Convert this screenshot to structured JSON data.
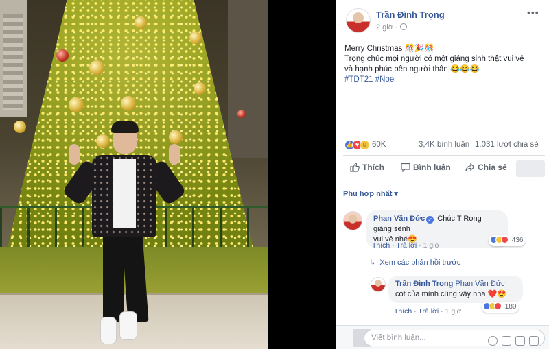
{
  "post": {
    "author": "Trần Đình Trọng",
    "time": "2 giờ",
    "more_icon": "more-options-icon",
    "text_line1": "Merry Christmas 🎊🎉🎊",
    "text_line2": "Trọng chúc mọi người có một giáng sinh thật vui vẻ",
    "text_line3": "và hạnh phúc bên người thân 😂😂😂",
    "hashtags": "#TDT21 #Noel"
  },
  "reactions": {
    "count": "60K",
    "comments": "3,4K bình luận",
    "shares": "1.031 lượt chia sẻ"
  },
  "actions": {
    "like": "Thích",
    "comment": "Bình luận",
    "share": "Chia sẻ"
  },
  "sort_label": "Phù hợp nhất ▾",
  "comments": [
    {
      "name": "Phan Văn Đức",
      "text_line1": "Chúc T Rong giáng sênh",
      "text_line2": "vui vẻ nhé😍",
      "like": "Thích",
      "reply": "Trả lời",
      "time": "1 giờ",
      "react_count": "436"
    }
  ],
  "view_previous": "Xem các phản hồi trước",
  "reply": {
    "name": "Trần Đình Trọng",
    "tag": "Phan Văn Đức",
    "text": "cọt của mình cũng vậy nha ❤️😍",
    "like": "Thích",
    "reply": "Trả lời",
    "time": "1 giờ",
    "react_count": "180"
  },
  "compose": {
    "placeholder": "Viết bình luận..."
  },
  "colors": {
    "link": "#365899",
    "meta": "#90949c",
    "like_blue": "#4a76e0",
    "love_red": "#f0464a",
    "haha_yellow": "#f4c542"
  }
}
